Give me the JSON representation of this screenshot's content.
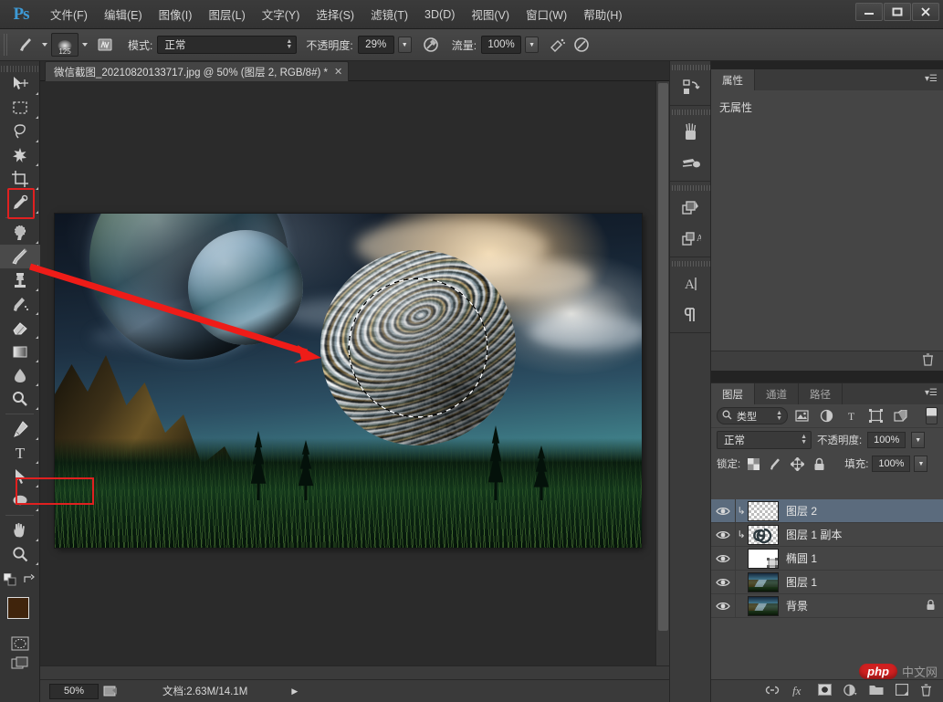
{
  "app": {
    "logo": "Ps"
  },
  "menubar": {
    "items": [
      {
        "label": "文件(F)"
      },
      {
        "label": "编辑(E)"
      },
      {
        "label": "图像(I)"
      },
      {
        "label": "图层(L)"
      },
      {
        "label": "文字(Y)"
      },
      {
        "label": "选择(S)"
      },
      {
        "label": "滤镜(T)"
      },
      {
        "label": "3D(D)"
      },
      {
        "label": "视图(V)"
      },
      {
        "label": "窗口(W)"
      },
      {
        "label": "帮助(H)"
      }
    ]
  },
  "window_controls": {
    "minimize": "—",
    "maximize": "❐",
    "close": "✕"
  },
  "options_bar": {
    "brush_size": "125",
    "mode_label": "模式:",
    "mode_value": "正常",
    "opacity_label": "不透明度:",
    "opacity_value": "29%",
    "flow_label": "流量:",
    "flow_value": "100%"
  },
  "toolbar": {
    "tools": [
      {
        "name": "move-tool",
        "glyph": "move"
      },
      {
        "name": "marquee-tool",
        "glyph": "marquee"
      },
      {
        "name": "lasso-tool",
        "glyph": "lasso"
      },
      {
        "name": "quick-selection-tool",
        "glyph": "wand"
      },
      {
        "name": "crop-tool",
        "glyph": "crop"
      },
      {
        "name": "eyedropper-tool",
        "glyph": "eyedropper"
      },
      {
        "name": "spot-healing-tool",
        "glyph": "heal"
      },
      {
        "name": "brush-tool",
        "glyph": "brush"
      },
      {
        "name": "clone-stamp-tool",
        "glyph": "stamp"
      },
      {
        "name": "history-brush-tool",
        "glyph": "historybrush"
      },
      {
        "name": "eraser-tool",
        "glyph": "eraser"
      },
      {
        "name": "gradient-tool",
        "glyph": "gradient"
      },
      {
        "name": "blur-tool",
        "glyph": "blur"
      },
      {
        "name": "dodge-tool",
        "glyph": "dodge"
      },
      {
        "name": "pen-tool",
        "glyph": "pen"
      },
      {
        "name": "type-tool",
        "glyph": "T"
      },
      {
        "name": "path-selection-tool",
        "glyph": "arrow"
      },
      {
        "name": "ellipse-tool",
        "glyph": "ellipse"
      },
      {
        "name": "hand-tool",
        "glyph": "hand"
      },
      {
        "name": "zoom-tool",
        "glyph": "zoom"
      }
    ],
    "active_tool": "brush-tool",
    "foreground_color": "#40240c",
    "background_color": "#000000"
  },
  "document_tab": {
    "title": "微信截图_20210820133717.jpg @ 50% (图层 2, RGB/8#) *",
    "close": "✕"
  },
  "status_bar": {
    "zoom": "50%",
    "doc_info": "文档:2.63M/14.1M",
    "expand_arrow": "▶"
  },
  "dock_strip": {
    "icons": [
      {
        "name": "history-panel-icon"
      },
      {
        "name": "brush-panel-icon"
      },
      {
        "name": "brush-presets-panel-icon"
      },
      {
        "name": "layer-comps-panel-icon"
      },
      {
        "name": "styles-panel-icon"
      },
      {
        "name": "character-panel-icon"
      },
      {
        "name": "paragraph-panel-icon"
      }
    ],
    "collapse": "▸▸"
  },
  "properties_panel": {
    "tab_label": "属性",
    "empty_message": "无属性",
    "menu_glyph": "▾☰"
  },
  "layers_panel": {
    "tabs": [
      {
        "label": "图层",
        "active": true
      },
      {
        "label": "通道",
        "active": false
      },
      {
        "label": "路径",
        "active": false
      }
    ],
    "menu_glyph": "▾☰",
    "filter": {
      "search_icon": "search-icon",
      "kind_label": "类型",
      "icons": [
        "filter-pixel-icon",
        "filter-adjustment-icon",
        "filter-type-icon",
        "filter-shape-icon",
        "filter-smartobject-icon"
      ]
    },
    "blend_mode": "正常",
    "opacity_label": "不透明度:",
    "opacity_value": "100%",
    "lock_label": "锁定:",
    "lock_icons": [
      "lock-transparent-icon",
      "lock-image-icon",
      "lock-position-icon",
      "lock-all-icon"
    ],
    "fill_label": "填充:",
    "fill_value": "100%",
    "layers": [
      {
        "name": "图层 2",
        "selected": true,
        "clipped": true,
        "thumb": "transparent",
        "locked": false,
        "visible": true
      },
      {
        "name": "图层 1 副本",
        "selected": false,
        "clipped": true,
        "thumb": "swirl",
        "locked": false,
        "visible": true
      },
      {
        "name": "椭圆 1",
        "selected": false,
        "clipped": false,
        "thumb": "shape",
        "locked": false,
        "visible": true
      },
      {
        "name": "图层 1",
        "selected": false,
        "clipped": false,
        "thumb": "landscape",
        "locked": false,
        "visible": true
      },
      {
        "name": "背景",
        "selected": false,
        "clipped": false,
        "thumb": "landscape",
        "locked": true,
        "visible": true
      }
    ],
    "footer_icons": [
      "link-layers-icon",
      "layer-style-fx-icon",
      "add-mask-icon",
      "adjustment-layer-icon",
      "new-group-icon",
      "new-layer-icon",
      "delete-layer-icon"
    ]
  },
  "watermark": {
    "badge": "php",
    "text": "中文网"
  },
  "annotations": {
    "brush_tool_highlight_color": "#e02020",
    "layer2_highlight_color": "#e02020",
    "arrow_color": "#ee1c18"
  }
}
